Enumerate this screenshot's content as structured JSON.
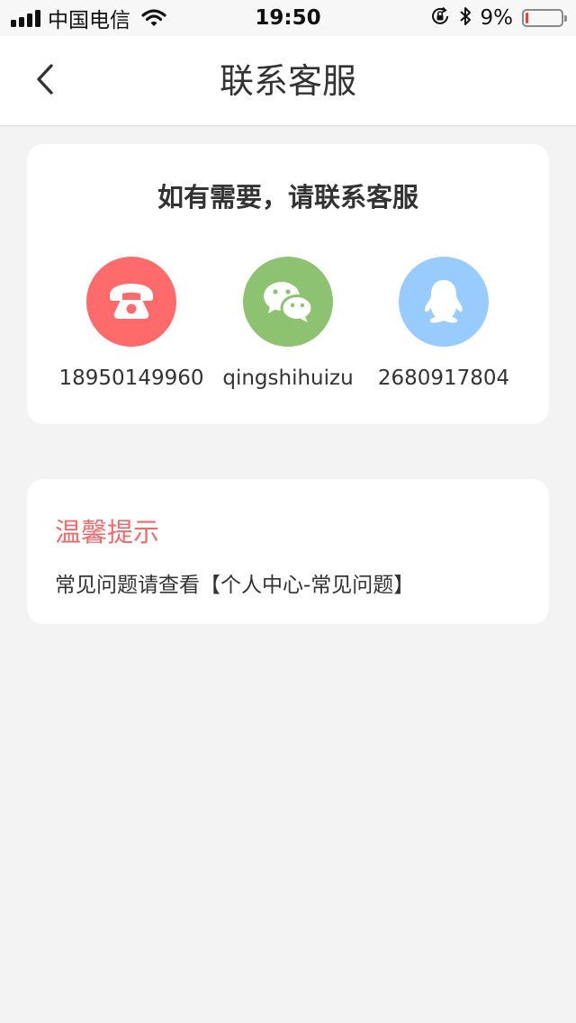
{
  "status_bar": {
    "carrier": "中国电信",
    "time": "19:50",
    "battery_percent": "9%",
    "battery_level": 0.09,
    "battery_color": "#ff3b30",
    "icons": [
      "signal-icon",
      "wifi-icon",
      "orientation-lock-icon",
      "bluetooth-icon",
      "battery-icon"
    ]
  },
  "nav": {
    "title": "联系客服",
    "back_icon": "chevron-left-icon"
  },
  "contact_card": {
    "title": "如有需要，请联系客服",
    "items": [
      {
        "icon": "phone-icon",
        "color": "#ff6b6b",
        "value": "18950149960"
      },
      {
        "icon": "wechat-icon",
        "color": "#8cc270",
        "value": "qingshihuizu"
      },
      {
        "icon": "qq-icon",
        "color": "#99ccfe",
        "value": "2680917804"
      }
    ]
  },
  "tip_card": {
    "title": "温馨提示",
    "title_color": "#ef6a6d",
    "text": "常见问题请查看【个人中心-常见问题】"
  }
}
